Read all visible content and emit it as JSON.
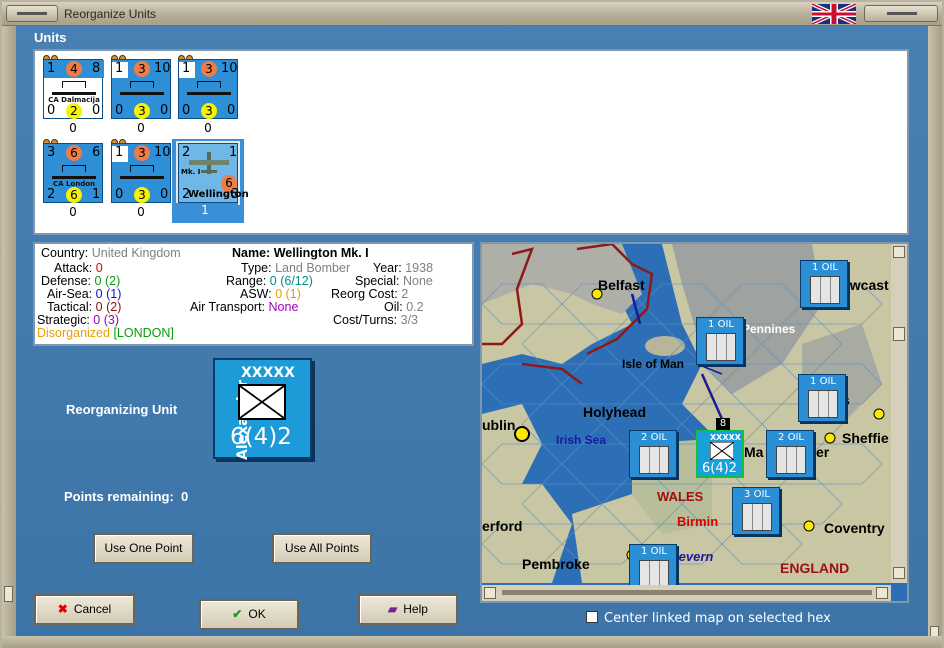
{
  "window": {
    "title": "Reorganize Units"
  },
  "units_section": {
    "label": "Units",
    "units": [
      {
        "top_left": "1",
        "top_mid": "4",
        "top_right": "8",
        "name": "CA Dalmacija",
        "bottom_left": "0",
        "bottom_mid": "2",
        "bottom_right": "0",
        "count": "0"
      },
      {
        "top_left": "1",
        "top_mid": "3",
        "top_right": "10",
        "name": "",
        "bottom_left": "0",
        "bottom_mid": "3",
        "bottom_right": "0",
        "count": "0"
      },
      {
        "top_left": "1",
        "top_mid": "3",
        "top_right": "10",
        "name": "",
        "bottom_left": "0",
        "bottom_mid": "3",
        "bottom_right": "0",
        "count": "0"
      },
      {
        "top_left": "3",
        "top_mid": "6",
        "top_right": "6",
        "name": "CA London",
        "bottom_left": "2",
        "bottom_mid": "6",
        "bottom_right": "1",
        "count": "0"
      },
      {
        "top_left": "1",
        "top_mid": "3",
        "top_right": "10",
        "name": "",
        "bottom_left": "0",
        "bottom_mid": "3",
        "bottom_right": "0",
        "count": "0"
      },
      {
        "top_left": "2",
        "top_mid": "",
        "top_right": "1",
        "name": "Wellington",
        "subname": "Mk. I",
        "bottom_left": "2",
        "bottom_mid": "6",
        "bottom_right": "3",
        "count": "1"
      }
    ]
  },
  "info": {
    "country_label": "Country:",
    "country": "United Kingdom",
    "attack_label": "Attack:",
    "attack": "0",
    "defense_label": "Defense:",
    "defense": "0",
    "defense_paren": "(2)",
    "airsea_label": "Air-Sea:",
    "airsea": "0",
    "airsea_paren": "(1)",
    "tactical_label": "Tactical:",
    "tactical": "0",
    "tactical_paren": "(2)",
    "strategic_label": "Strategic:",
    "strategic": "0",
    "strategic_paren": "(3)",
    "status": "Disorganized",
    "status_loc": "[LONDON]",
    "name_label": "Name:",
    "name": "Wellington Mk. I",
    "type_label": "Type:",
    "type": "Land Bomber",
    "year_label": "Year:",
    "year": "1938",
    "range_label": "Range:",
    "range": "0 (6/12)",
    "special_label": "Special:",
    "special": "None",
    "asw_label": "ASW:",
    "asw": "0 (1)",
    "reorg_label": "Reorg Cost:",
    "reorg": "2",
    "airtransport_label": "Air Transport:",
    "airtransport": "None",
    "oil_label": "Oil:",
    "oil": "0.2",
    "costturns_label": "Cost/Turns:",
    "costturns": "3/3"
  },
  "reorg": {
    "label": "Reorganizing Unit",
    "counter_top": "XXXXX",
    "counter_side": "Alexander",
    "counter_strength": "6(4)2",
    "points_label": "Points remaining:",
    "points": "0"
  },
  "buttons": {
    "use_one": "Use One Point",
    "use_all": "Use All Points",
    "cancel": "Cancel",
    "ok": "OK",
    "help": "Help"
  },
  "map": {
    "labels": {
      "belfast": "Belfast",
      "pennines": "Pennines",
      "newcastle": "ewcast",
      "isle_of_man": "Isle of Man",
      "holyhead": "Holyhead",
      "dublin": "ublin",
      "irish_sea": "Irish Sea",
      "manchester": "Ma",
      "manchester2": "er",
      "sheffield": "Sheffie",
      "wales": "WALES",
      "birmingham": "Birmin",
      "coventry": "Coventry",
      "erford": "erford",
      "pembroke": "Pembroke",
      "severn": "Severn",
      "england": "ENGLAND",
      "leeds_s": "s",
      "f_char": "f"
    },
    "oil_label": "1 OIL",
    "oil_label2": "2 OIL",
    "oil_label3": "3 OIL",
    "hq_top": "XXXXX",
    "hq_strength": "6(4)2",
    "hq_stack": "8"
  },
  "center_linked": {
    "label": "Center linked map on selected hex",
    "checked": false
  },
  "colors": {
    "panel_bg": "#3d74a8",
    "counter_blue": "#2f8fd6",
    "sea": "#2d6fb6"
  }
}
